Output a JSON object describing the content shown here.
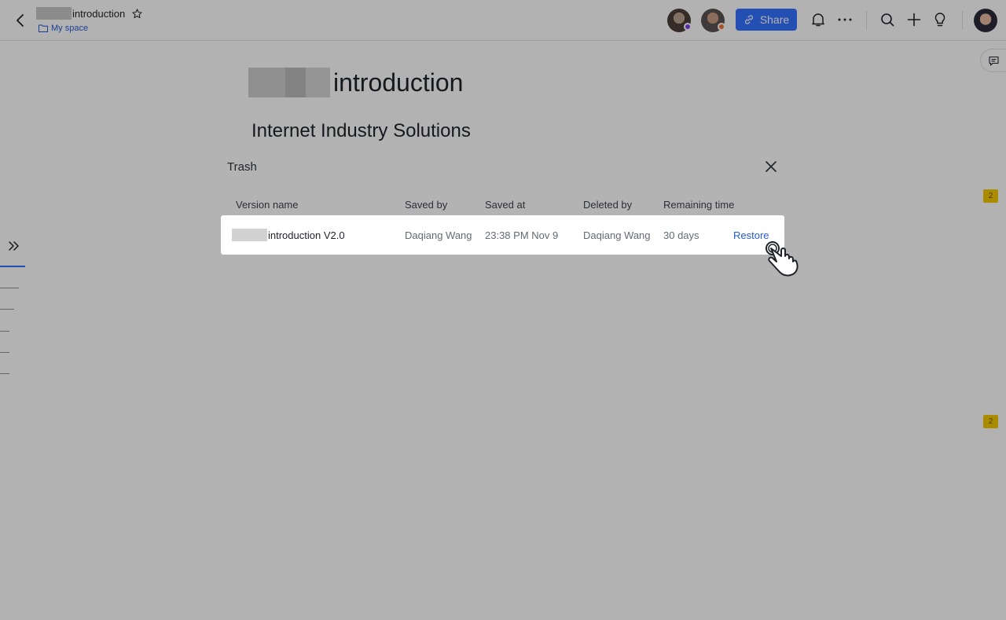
{
  "header": {
    "doc_title": "introduction",
    "breadcrumb": "My space",
    "share_label": "Share",
    "icons": [
      "back-arrow-icon",
      "star-icon",
      "folder-icon",
      "link-icon",
      "bell-icon",
      "more-icon",
      "search-icon",
      "plus-icon",
      "lightbulb-icon"
    ],
    "presence_colors": {
      "user1": "#7f3bf5",
      "user2": "#f77234"
    }
  },
  "document": {
    "heading_1": "introduction",
    "heading_2": "Internet Industry Solutions",
    "comment_tags": [
      "2",
      "2"
    ]
  },
  "dialog": {
    "title": "Trash",
    "columns": [
      "Version name",
      "Saved by",
      "Saved at",
      "Deleted by",
      "Remaining time"
    ],
    "rows": [
      {
        "version_name": "introduction V2.0",
        "saved_by": "Daqiang Wang",
        "saved_at": "23:38 PM Nov 9",
        "deleted_by": "Daqiang Wang",
        "remaining_time": "30 days",
        "action": "Restore"
      }
    ]
  },
  "colors": {
    "accent": "#3370ff",
    "link": "#245bdb",
    "comment_tag": "#f5c900"
  }
}
